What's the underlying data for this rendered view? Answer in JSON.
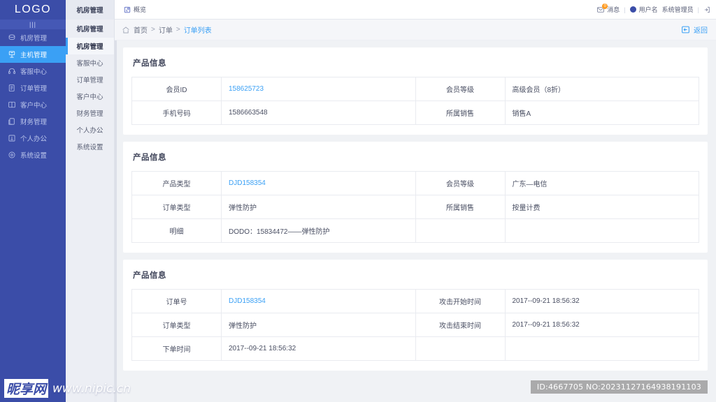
{
  "brand": {
    "logo": "LOGO",
    "logo_sub": "|||"
  },
  "colors": {
    "sidebar": "#3b4da8",
    "accent": "#3aa0f5",
    "badge": "#ff9a1f",
    "link": "#3aa0f5"
  },
  "sidebar": {
    "items": [
      {
        "label": "机房管理",
        "icon": "server-icon",
        "active": false
      },
      {
        "label": "主机管理",
        "icon": "host-icon",
        "active": true
      },
      {
        "label": "客服中心",
        "icon": "headset-icon",
        "active": false
      },
      {
        "label": "订单管理",
        "icon": "order-icon",
        "active": false
      },
      {
        "label": "客户中心",
        "icon": "customer-icon",
        "active": false
      },
      {
        "label": "财务管理",
        "icon": "finance-icon",
        "active": false
      },
      {
        "label": "个人办公",
        "icon": "office-icon",
        "active": false
      },
      {
        "label": "系统设置",
        "icon": "settings-icon",
        "active": false
      }
    ]
  },
  "subnav": {
    "header": "机房管理",
    "items": [
      {
        "label": "机房管理",
        "active": true
      },
      {
        "label": "客服中心",
        "active": false
      },
      {
        "label": "订单管理",
        "active": false
      },
      {
        "label": "客户中心",
        "active": false
      },
      {
        "label": "财务管理",
        "active": false
      },
      {
        "label": "个人办公",
        "active": false
      },
      {
        "label": "系统设置",
        "active": false
      }
    ]
  },
  "topbar": {
    "tab": {
      "label": "概览",
      "icon": "overview-icon"
    },
    "message": {
      "label": "消息",
      "icon": "mail-icon",
      "badge": "0"
    },
    "user": {
      "name": "用户名",
      "role": "系统管理员",
      "avatar": "avatar-dot"
    },
    "logout_icon": "logout-icon",
    "separator": "|"
  },
  "breadcrumb": {
    "home_icon": "home-icon",
    "items": [
      "首页",
      "订单",
      "订单列表"
    ],
    "separator": ">",
    "back": {
      "label": "返回",
      "icon": "back-arrow-icon"
    }
  },
  "cards": [
    {
      "title": "产品信息",
      "rows": [
        {
          "label_left": "会员ID",
          "value_left": "158625723",
          "link_left": true,
          "label_right": "会员等级",
          "value_right": "高级会员（8折）"
        },
        {
          "label_left": "手机号码",
          "value_left": "1586663548",
          "link_left": false,
          "label_right": "所属销售",
          "value_right": "销售A"
        }
      ]
    },
    {
      "title": "产品信息",
      "rows": [
        {
          "label_left": "产品类型",
          "value_left": "DJD158354",
          "link_left": true,
          "label_right": "会员等级",
          "value_right": "广东—电信"
        },
        {
          "label_left": "订单类型",
          "value_left": "弹性防护",
          "link_left": false,
          "label_right": "所属销售",
          "value_right": "按量计费"
        },
        {
          "label_left": "明细",
          "value_left": "DODO：15834472——弹性防护",
          "link_left": false,
          "label_right": "",
          "value_right": ""
        }
      ]
    },
    {
      "title": "产品信息",
      "rows": [
        {
          "label_left": "订单号",
          "value_left": "DJD158354",
          "link_left": true,
          "label_right": "攻击开始时间",
          "value_right": "2017--09-21  18:56:32"
        },
        {
          "label_left": "订单类型",
          "value_left": "弹性防护",
          "link_left": false,
          "label_right": "攻击结束时间",
          "value_right": "2017--09-21  18:56:32"
        },
        {
          "label_left": "下单时间",
          "value_left": "2017--09-21  18:56:32",
          "link_left": false,
          "label_right": "",
          "value_right": ""
        }
      ]
    }
  ],
  "watermark": {
    "logo": "昵享网",
    "url": "www.nipic.cn"
  },
  "id_badge": "ID:4667705 NO:20231127164938191103"
}
